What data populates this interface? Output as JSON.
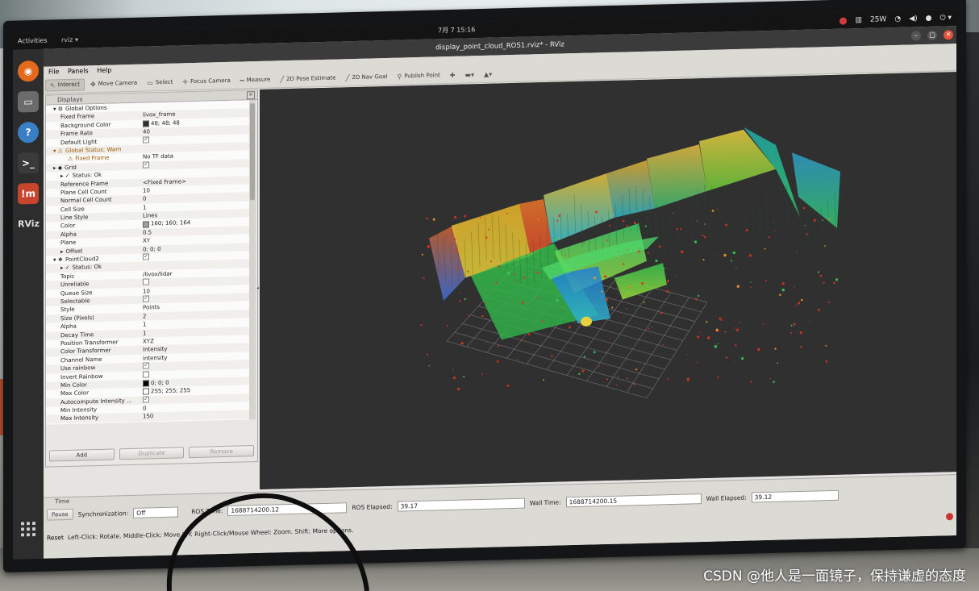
{
  "topbar": {
    "activities": "Activities",
    "app_menu": "rviz ▾",
    "clock": "7月 7  15:16",
    "power": "25W"
  },
  "window": {
    "title": "display_point_cloud_ROS1.rviz* - RViz"
  },
  "menu": [
    "File",
    "Panels",
    "Help"
  ],
  "toolbar": [
    {
      "label": "Interact",
      "icon": "interact-icon",
      "active": true
    },
    {
      "label": "Move Camera",
      "icon": "move-camera-icon"
    },
    {
      "label": "Select",
      "icon": "select-icon"
    },
    {
      "label": "Focus Camera",
      "icon": "focus-camera-icon"
    },
    {
      "label": "Measure",
      "icon": "measure-icon"
    },
    {
      "label": "2D Pose Estimate",
      "icon": "pose-estimate-icon"
    },
    {
      "label": "2D Nav Goal",
      "icon": "nav-goal-icon"
    },
    {
      "label": "Publish Point",
      "icon": "publish-point-icon"
    }
  ],
  "displays": {
    "title": "Displays",
    "rows": [
      {
        "name": "Global Options",
        "value": "",
        "indent": 1,
        "icon": "▾ ⚙"
      },
      {
        "name": "Fixed Frame",
        "value": "livox_frame",
        "indent": 2
      },
      {
        "name": "Background Color",
        "value": "48; 48; 48",
        "indent": 2,
        "swatch": "#303030"
      },
      {
        "name": "Frame Rate",
        "value": "40",
        "indent": 2
      },
      {
        "name": "Default Light",
        "value": "",
        "indent": 2,
        "check": true
      },
      {
        "name": "Global Status: Warn",
        "value": "",
        "indent": 1,
        "icon": "▾ ⚠",
        "cls": "warn"
      },
      {
        "name": "Fixed Frame",
        "value": "No TF data",
        "indent": 3,
        "icon": "⚠",
        "cls": "warn"
      },
      {
        "name": "Grid",
        "value": "",
        "indent": 1,
        "icon": "▸ ◆",
        "check": true
      },
      {
        "name": "Status: Ok",
        "value": "",
        "indent": 2,
        "icon": "▸ ✓"
      },
      {
        "name": "Reference Frame",
        "value": "<Fixed Frame>",
        "indent": 2
      },
      {
        "name": "Plane Cell Count",
        "value": "10",
        "indent": 2
      },
      {
        "name": "Normal Cell Count",
        "value": "0",
        "indent": 2
      },
      {
        "name": "Cell Size",
        "value": "1",
        "indent": 2
      },
      {
        "name": "Line Style",
        "value": "Lines",
        "indent": 2
      },
      {
        "name": "Color",
        "value": "160; 160; 164",
        "indent": 2,
        "swatch": "#a0a0a4"
      },
      {
        "name": "Alpha",
        "value": "0.5",
        "indent": 2
      },
      {
        "name": "Plane",
        "value": "XY",
        "indent": 2
      },
      {
        "name": "Offset",
        "value": "0; 0; 0",
        "indent": 2,
        "icon": "▸"
      },
      {
        "name": "PointCloud2",
        "value": "",
        "indent": 1,
        "icon": "▾ ❖",
        "check": true
      },
      {
        "name": "Status: Ok",
        "value": "",
        "indent": 2,
        "icon": "▸ ✓"
      },
      {
        "name": "Topic",
        "value": "/livox/lidar",
        "indent": 2
      },
      {
        "name": "Unreliable",
        "value": "",
        "indent": 2,
        "check": false
      },
      {
        "name": "Queue Size",
        "value": "10",
        "indent": 2
      },
      {
        "name": "Selectable",
        "value": "",
        "indent": 2,
        "check": true
      },
      {
        "name": "Style",
        "value": "Points",
        "indent": 2
      },
      {
        "name": "Size (Pixels)",
        "value": "2",
        "indent": 2
      },
      {
        "name": "Alpha",
        "value": "1",
        "indent": 2
      },
      {
        "name": "Decay Time",
        "value": "1",
        "indent": 2
      },
      {
        "name": "Position Transformer",
        "value": "XYZ",
        "indent": 2
      },
      {
        "name": "Color Transformer",
        "value": "Intensity",
        "indent": 2
      },
      {
        "name": "Channel Name",
        "value": "intensity",
        "indent": 2
      },
      {
        "name": "Use rainbow",
        "value": "",
        "indent": 2,
        "check": true
      },
      {
        "name": "Invert Rainbow",
        "value": "",
        "indent": 2,
        "check": false
      },
      {
        "name": "Min Color",
        "value": "0; 0; 0",
        "indent": 2,
        "swatch": "#000000"
      },
      {
        "name": "Max Color",
        "value": "255; 255; 255",
        "indent": 2,
        "swatch": "#ffffff"
      },
      {
        "name": "Autocompute Intensity ...",
        "value": "",
        "indent": 2,
        "check": true
      },
      {
        "name": "Min Intensity",
        "value": "0",
        "indent": 2
      },
      {
        "name": "Max Intensity",
        "value": "150",
        "indent": 2
      }
    ],
    "buttons": {
      "add": "Add",
      "duplicate": "Duplicate",
      "remove": "Remove"
    }
  },
  "time": {
    "title": "Time",
    "pause": "Pause",
    "sync_label": "Synchronization:",
    "sync_value": "Off",
    "ros_time_label": "ROS Time:",
    "ros_time": "1688714200.12",
    "ros_elapsed_label": "ROS Elapsed:",
    "ros_elapsed": "39.17",
    "wall_time_label": "Wall Time:",
    "wall_time": "1688714200.15",
    "wall_elapsed_label": "Wall Elapsed:",
    "wall_elapsed": "39.12"
  },
  "status": {
    "reset": "Reset",
    "hint": "Left-Click: Rotate.  Middle-Click: Move X/Y.  Right-Click/Mouse Wheel: Zoom.  Shift: More options."
  },
  "watermark": "CSDN @他人是一面镜子，保持谦虚的态度",
  "colors": {
    "viewport_bg": "#303030",
    "grid": "#a0a0a4"
  }
}
